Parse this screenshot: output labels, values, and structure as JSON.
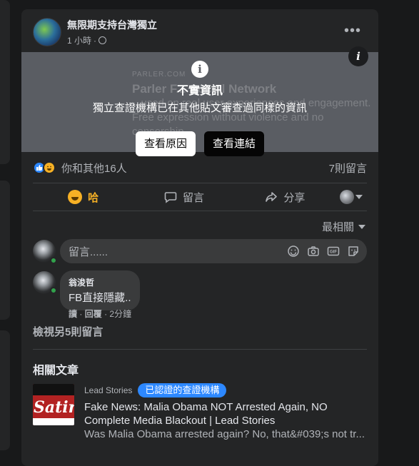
{
  "post": {
    "page_name": "無限期支持台灣獨立",
    "time": "1 小時",
    "privacy_icon": "globe-icon",
    "more_icon": "more-icon"
  },
  "fact_check": {
    "ghost_url": "PARLER.COM",
    "ghost_title": "Parler F... Social Network",
    "ghost_desc": "...used on real user experiences and engagement. Free expression without violence and no censorship....",
    "title": "不實資訊",
    "subtitle": "獨立查證機構已在其他貼文審查過同樣的資訊",
    "btn_why": "查看原因",
    "btn_link": "查看連結"
  },
  "reactions": {
    "summary": "你和其他16人",
    "comments": "7則留言"
  },
  "actions": {
    "haha": "哈",
    "comment": "留言",
    "share": "分享"
  },
  "comments": {
    "sort_label": "最相關",
    "placeholder": "留言......",
    "items": [
      {
        "author": "翁浚哲",
        "text": "FB直接隱藏..",
        "read": "讀",
        "reply": "回覆",
        "time": "2分鐘"
      }
    ],
    "view_more": "檢視另5則留言"
  },
  "related": {
    "heading": "相關文章",
    "source": "Lead Stories",
    "badge": "已認證的查證機構",
    "title": "Fake News: Malia Obama NOT Arrested Again, NO Complete Media Blackout | Lead Stories",
    "desc": "Was Malia Obama arrested again? No, that&#039;s not tr...",
    "thumb_text": "Satire"
  },
  "colors": {
    "background": "#18191a",
    "card": "#242526",
    "accent": "#2d88ff",
    "haha": "#f7b125",
    "online": "#31a24c"
  }
}
